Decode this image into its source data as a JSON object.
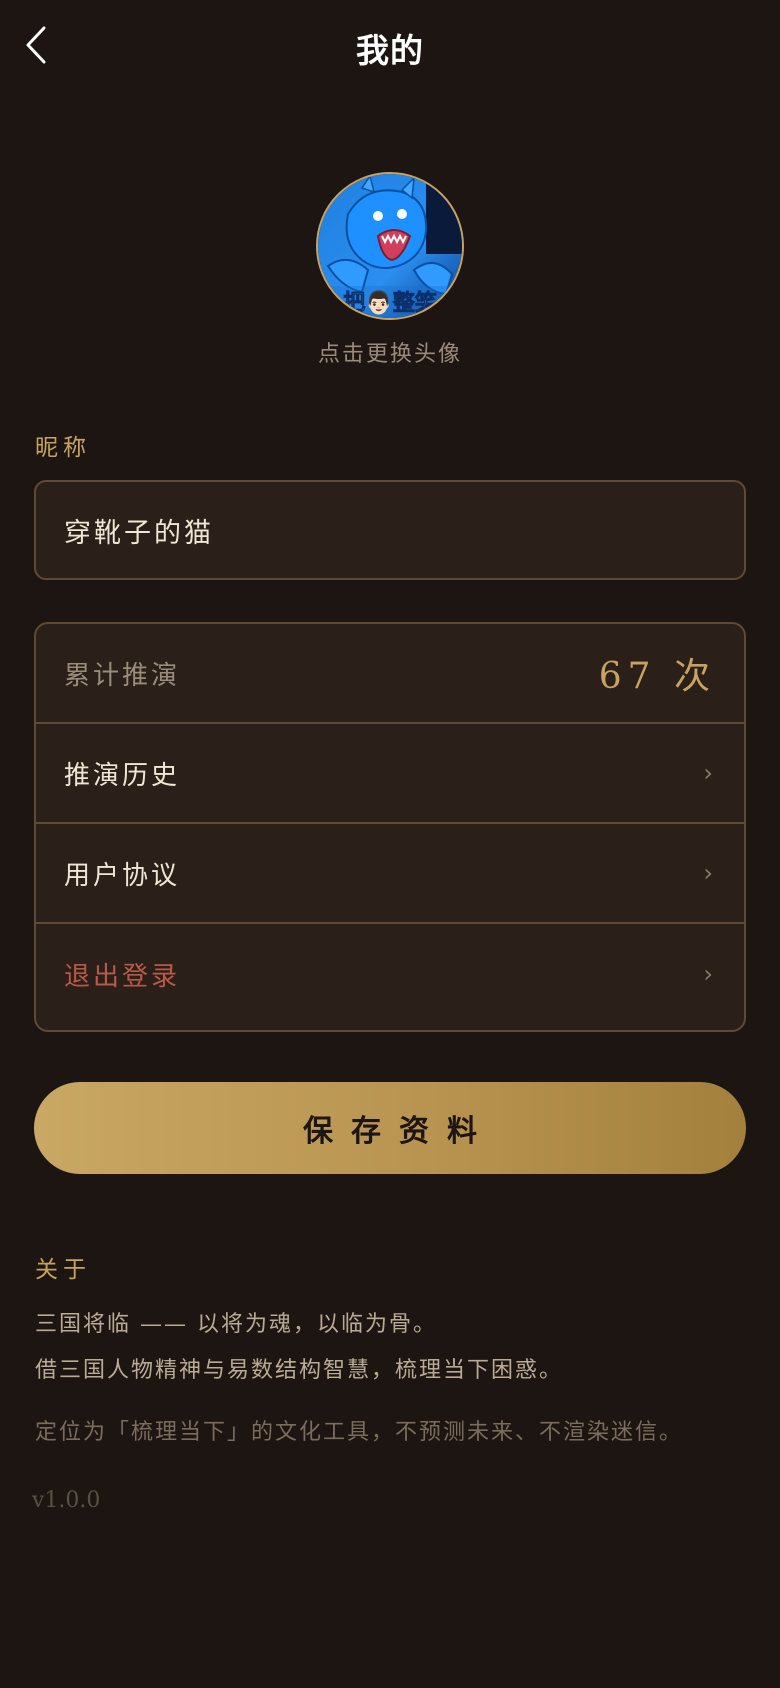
{
  "header": {
    "title": "我的",
    "back_icon": "chevron-left-icon"
  },
  "avatar": {
    "hint": "点击更换头像",
    "caption": "把👨🏻整笑"
  },
  "nickname": {
    "label": "昵称",
    "value": "穿靴子的猫"
  },
  "menu": {
    "stats_label": "累计推演",
    "stats_value": "67 次",
    "items": [
      {
        "label": "推演历史",
        "chevron": "›"
      },
      {
        "label": "用户协议",
        "chevron": "›"
      },
      {
        "label": "退出登录",
        "chevron": "›"
      }
    ]
  },
  "save_button": {
    "label": "保存资料"
  },
  "about": {
    "title": "关于",
    "line1": "三国将临 —— 以将为魂，以临为骨。",
    "line2": "借三国人物精神与易数结构智慧，梳理当下困惑。",
    "line3": "定位为「梳理当下」的文化工具，不预测未来、不渲染迷信。"
  },
  "version": "v1.0.0",
  "colors": {
    "background": "#1d1511",
    "accent_gold": "#c9a35e",
    "danger": "#b95a48",
    "card_bg": "#2a2019",
    "border": "#5e4a35"
  }
}
